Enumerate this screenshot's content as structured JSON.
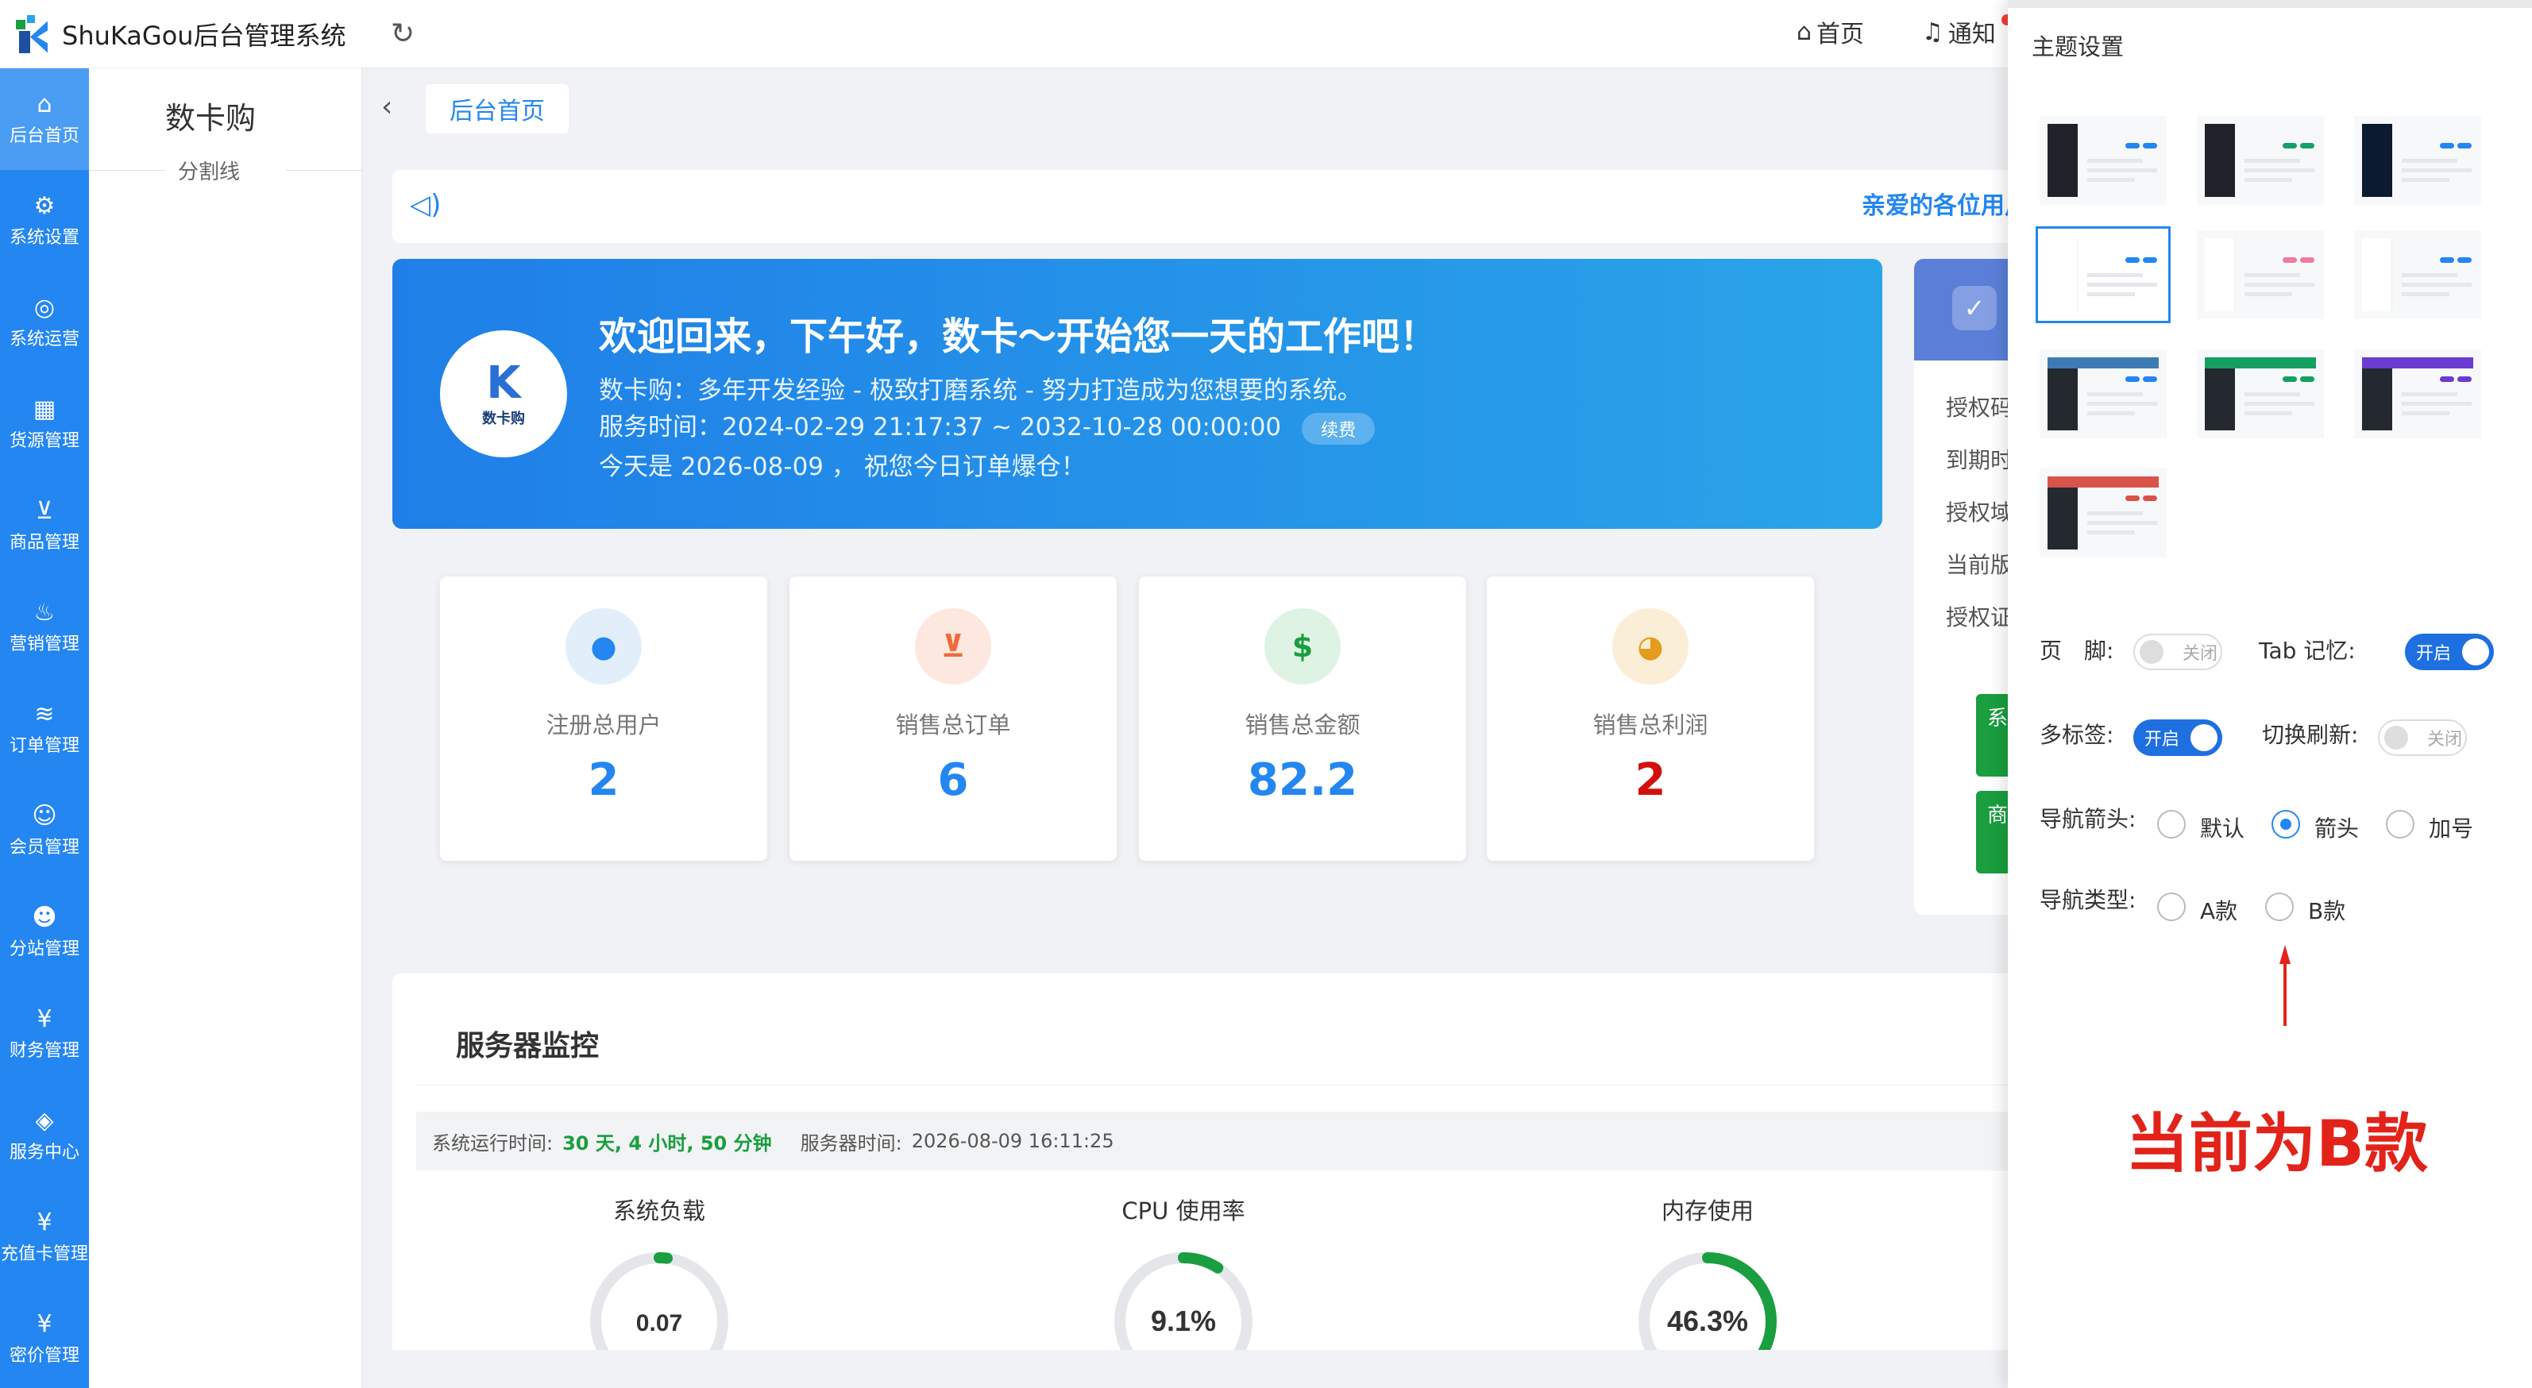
{
  "app": {
    "title": "ShuKaGou后台管理系统"
  },
  "header": {
    "refresh_icon": "refresh-icon",
    "home_label": "首页",
    "notify_label": "通知"
  },
  "nav": {
    "items": [
      {
        "label": "后台首页",
        "icon": "home-icon",
        "glyph": "⌂"
      },
      {
        "label": "系统设置",
        "icon": "gear-icon",
        "glyph": "⚙"
      },
      {
        "label": "系统运营",
        "icon": "circle-arrow-icon",
        "glyph": "◎"
      },
      {
        "label": "货源管理",
        "icon": "grid-icon",
        "glyph": "▦"
      },
      {
        "label": "商品管理",
        "icon": "cart-icon",
        "glyph": "⊻"
      },
      {
        "label": "营销管理",
        "icon": "flame-icon",
        "glyph": "♨"
      },
      {
        "label": "订单管理",
        "icon": "layers-icon",
        "glyph": "≋"
      },
      {
        "label": "会员管理",
        "icon": "user-icon",
        "glyph": "☺"
      },
      {
        "label": "分站管理",
        "icon": "users-icon",
        "glyph": "☻"
      },
      {
        "label": "财务管理",
        "icon": "yen-icon",
        "glyph": "¥"
      },
      {
        "label": "服务中心",
        "icon": "apps-icon",
        "glyph": "◈"
      },
      {
        "label": "充值卡管理",
        "icon": "yen-icon",
        "glyph": "¥"
      },
      {
        "label": "密价管理",
        "icon": "yen-icon",
        "glyph": "¥"
      }
    ]
  },
  "sidebar": {
    "title": "数卡购",
    "divider_label": "分割线"
  },
  "tabs": {
    "active_label": "后台首页"
  },
  "notice": {
    "text": "亲爱的各位用户"
  },
  "welcome": {
    "avatar_text": "数卡购",
    "title": "欢迎回来，下午好，数卡～开始您一天的工作吧！",
    "line1": "数卡购：多年开发经验 - 极致打磨系统 - 努力打造成为您想要的系统。",
    "line2": "服务时间：2024-02-29 21:17:37 ~ 2032-10-28 00:00:00",
    "renew_label": "续费",
    "line3": "今天是 2026-08-09 ， 祝您今日订单爆仓！"
  },
  "stats": [
    {
      "label": "注册总用户",
      "value": "2",
      "icon": "user-icon",
      "glyph": "●",
      "color": "#2486f0",
      "bg": "#e3eefb",
      "val_color": "#2486f0"
    },
    {
      "label": "销售总订单",
      "value": "6",
      "icon": "cart-icon",
      "glyph": "⊻",
      "color": "#ef6b3a",
      "bg": "#fde8df",
      "val_color": "#2486f0"
    },
    {
      "label": "销售总金额",
      "value": "82.2",
      "icon": "dollar-icon",
      "glyph": "$",
      "color": "#1a9e3f",
      "bg": "#dff3e4",
      "val_color": "#2486f0"
    },
    {
      "label": "销售总利润",
      "value": "2",
      "icon": "coins-icon",
      "glyph": "◕",
      "color": "#e59b1c",
      "bg": "#fbeed6",
      "val_color": "#d40f0f"
    }
  ],
  "info_card": {
    "rows": [
      "授权码",
      "到期时",
      "授权域",
      "当前版",
      "授权证"
    ],
    "btn1": "系置",
    "btn2": "商理"
  },
  "monitor": {
    "title": "服务器监控",
    "uptime_label": "系统运行时间:",
    "uptime_value": "30 天, 4 小时, 50 分钟",
    "server_time_label": "服务器时间:",
    "server_time_value": "2026-08-09 16:11:25",
    "gauges": [
      {
        "title": "系统负载",
        "value": "0.07",
        "fraction": 0.02
      },
      {
        "title": "CPU 使用率",
        "value": "9.1%",
        "fraction": 0.091
      },
      {
        "title": "内存使用",
        "value": "46.3%",
        "fraction": 0.463
      }
    ]
  },
  "drawer": {
    "title": "主题设置",
    "themes": [
      {
        "name": "theme-dark-blue",
        "side": "#20222a",
        "top": "#f7f8fa",
        "dot": "#2486f0"
      },
      {
        "name": "theme-dark-green",
        "side": "#20222a",
        "top": "#f7f8fa",
        "dot": "#14a06a"
      },
      {
        "name": "theme-navy-blue",
        "side": "#0b1a2e",
        "top": "#f7f8fa",
        "dot": "#2486f0"
      },
      {
        "name": "theme-light-blue",
        "side": "#ffffff",
        "top": "#ffffff",
        "dot": "#2486f0",
        "selected": true
      },
      {
        "name": "theme-light-pink",
        "side": "#ffffff",
        "top": "#ffffff",
        "dot": "#f07aa0"
      },
      {
        "name": "theme-light-multi",
        "side": "#ffffff",
        "top": "#ffffff",
        "dot": "#2486f0"
      },
      {
        "name": "theme-topbar-steel",
        "side": "#24292f",
        "top": "#3d7bb5",
        "dot": "#2486f0"
      },
      {
        "name": "theme-topbar-green",
        "side": "#24292f",
        "top": "#13a060",
        "dot": "#13a060"
      },
      {
        "name": "theme-topbar-purple",
        "side": "#24292f",
        "top": "#6c3bd1",
        "dot": "#6c3bd1"
      },
      {
        "name": "theme-topbar-red",
        "side": "#24292f",
        "top": "#d9534a",
        "dot": "#d9534a"
      }
    ],
    "footer_label": "页　脚:",
    "footer_state": "关闭",
    "tab_memory_label": "Tab 记忆:",
    "tab_memory_state": "开启",
    "multi_tab_label": "多标签:",
    "multi_tab_state": "开启",
    "switch_refresh_label": "切换刷新:",
    "switch_refresh_state": "关闭",
    "nav_arrow_label": "导航箭头:",
    "nav_arrow_options": [
      "默认",
      "箭头",
      "加号"
    ],
    "nav_arrow_selected": 1,
    "nav_type_label": "导航类型:",
    "nav_type_options": [
      "A款",
      "B款"
    ],
    "nav_type_selected": -1
  },
  "annotation": {
    "text": "当前为B款",
    "color": "#e2231a"
  }
}
